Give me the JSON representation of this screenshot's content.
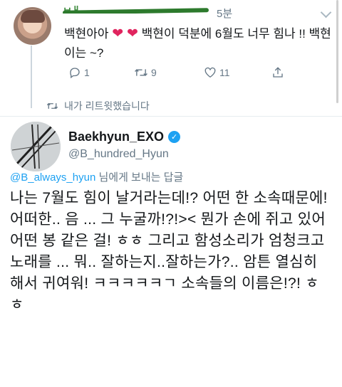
{
  "top_tweet": {
    "name": "ㅂㅐ",
    "time": "5분",
    "text_part1": "백현아아 ",
    "heart1": "❤",
    "heart2": "❤",
    "text_part2": " 백현이 덕분에 6월도 너무 힘나 !!  백현이는 ~?",
    "reply_count": "1",
    "retweet_count": "9",
    "like_count": "11",
    "retweeted_label": "내가 리트윗했습니다"
  },
  "main_tweet": {
    "name": "Baekhyun_EXO",
    "handle": "@B_hundred_Hyun",
    "reply_mention": "@B_always_hyun",
    "reply_suffix": " 님에게 보내는 답글",
    "text": "나는 7월도 힘이 날거라는데!? 어떤 한 소속때문에! 어떠한.. 음 ... 그 누굴까!?!>< 뭔가 손에 쥐고 있어 어떤 봉 같은 걸! ㅎㅎ 그리고 함성소리가 엄청크고 노래를 ... 뭐.. 잘하는지..잘하는가?.. 암튼 열심히해서 귀여워! ㅋㅋㅋㅋㅋㄱ 소속들의 이름은!?! ㅎㅎ"
  },
  "icons": {
    "reply": "reply-icon",
    "retweet": "retweet-icon",
    "like": "heart-icon",
    "more": "chevron-down-icon",
    "verified": "verified-badge-icon"
  },
  "colors": {
    "accent": "#1da1f2",
    "muted": "#657786",
    "heart": "#e0245e"
  }
}
